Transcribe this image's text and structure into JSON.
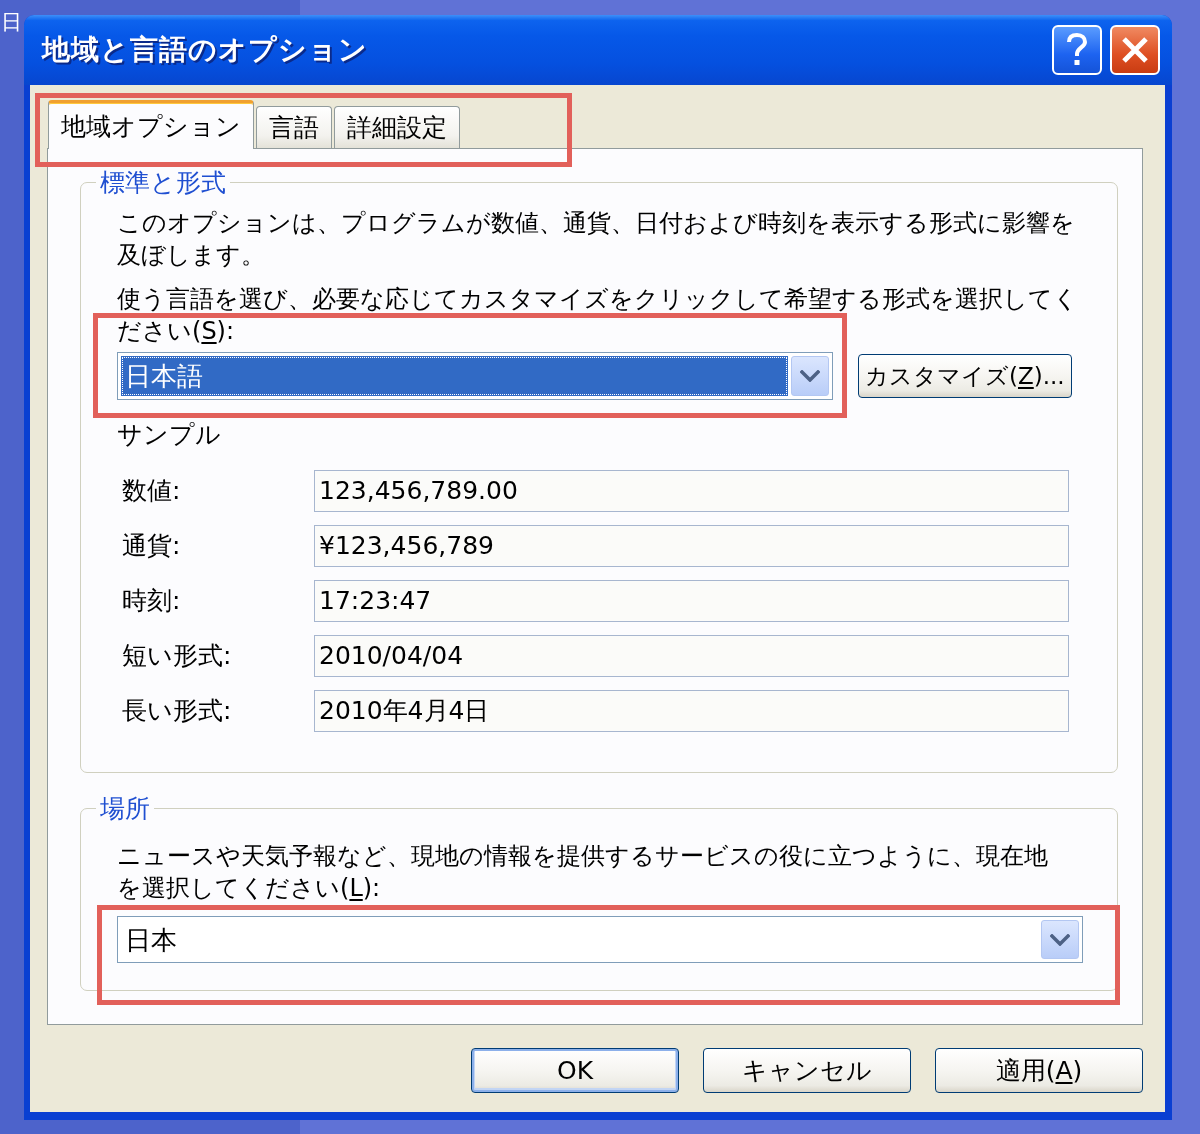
{
  "background_window": {
    "text": "日"
  },
  "window": {
    "title": "地域と言語のオプション"
  },
  "title_buttons": [
    {
      "kind": "help"
    },
    {
      "kind": "close"
    }
  ],
  "tabs": [
    {
      "label": "地域オプション",
      "selected": true
    },
    {
      "label": "言語",
      "selected": false
    },
    {
      "label": "詳細設定",
      "selected": false
    }
  ],
  "standards_group": {
    "title": "標準と形式",
    "description": "このオプションは、プログラムが数値、通貨、日付および時刻を表示する形式に影響を及ぼします。",
    "prompt": {
      "text": "使う言語を選び、必要な応じてカスタマイズをクリックして希望する形式を選択してください(S):",
      "access_key_underlined": true
    },
    "language_select": {
      "value": "日本語",
      "focused": true
    },
    "customize_button": {
      "label": "カスタマイズ(Z)...",
      "access_key_underlined": true
    },
    "sample_title": "サンプル",
    "samples": [
      {
        "label": "数値:",
        "value": "123,456,789.00"
      },
      {
        "label": "通貨:",
        "value": "¥123,456,789"
      },
      {
        "label": "時刻:",
        "value": "17:23:47"
      },
      {
        "label": "短い形式:",
        "value": "2010/04/04"
      },
      {
        "label": "長い形式:",
        "value": "2010年4月4日"
      }
    ]
  },
  "location_group": {
    "title": "場所",
    "prompt": {
      "text": "ニュースや天気予報など、現地の情報を提供するサービスの役に立つように、現在地を選択してください(L):",
      "access_key_underlined": true
    },
    "location_select": {
      "value": "日本",
      "focused": false
    }
  },
  "buttons": [
    {
      "label": "OK",
      "default": true
    },
    {
      "label": "キャンセル",
      "default": false
    },
    {
      "label": "適用(A)",
      "access_key_underlined": true,
      "default": false
    }
  ],
  "highlight_frames": [
    {
      "kind": "tabs"
    },
    {
      "kind": "language_select"
    },
    {
      "kind": "location_select"
    }
  ]
}
